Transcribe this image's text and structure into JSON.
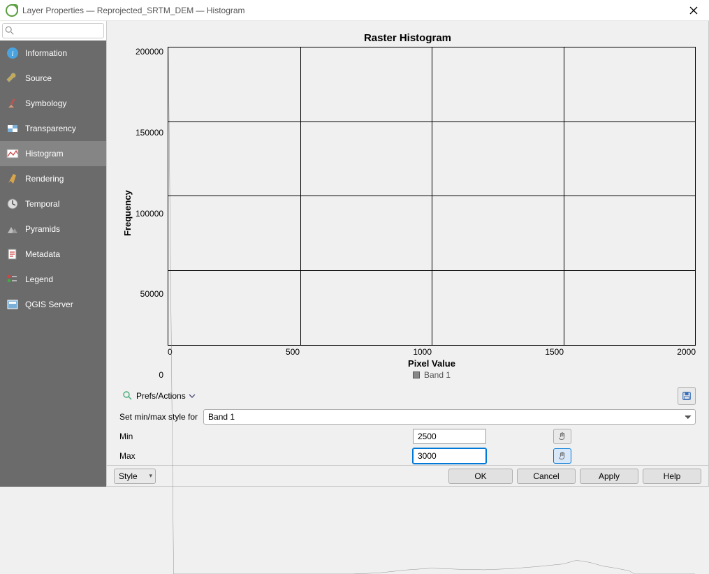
{
  "window": {
    "title": "Layer Properties — Reprojected_SRTM_DEM — Histogram",
    "search_placeholder": ""
  },
  "sidebar": {
    "items": [
      {
        "label": "Information",
        "icon": "info-icon"
      },
      {
        "label": "Source",
        "icon": "wrench-icon"
      },
      {
        "label": "Symbology",
        "icon": "paintbrush-icon"
      },
      {
        "label": "Transparency",
        "icon": "transparency-icon"
      },
      {
        "label": "Histogram",
        "icon": "histogram-icon"
      },
      {
        "label": "Rendering",
        "icon": "brush-icon"
      },
      {
        "label": "Temporal",
        "icon": "clock-icon"
      },
      {
        "label": "Pyramids",
        "icon": "pyramids-icon"
      },
      {
        "label": "Metadata",
        "icon": "metadata-icon"
      },
      {
        "label": "Legend",
        "icon": "legend-icon"
      },
      {
        "label": "QGIS Server",
        "icon": "server-icon"
      }
    ],
    "selected": 4
  },
  "chart_data": {
    "type": "line",
    "title": "Raster Histogram",
    "xlabel": "Pixel Value",
    "ylabel": "Frequency",
    "xlim": [
      0,
      2000
    ],
    "ylim": [
      0,
      200000
    ],
    "xticks": [
      0,
      500,
      1000,
      1500,
      2000
    ],
    "yticks": [
      0,
      50000,
      100000,
      150000,
      200000
    ],
    "series": [
      {
        "name": "Band 1",
        "x": [
          0,
          20,
          50,
          700,
          800,
          900,
          1000,
          1100,
          1200,
          1300,
          1400,
          1500,
          1550,
          1600,
          1650,
          1700,
          1750,
          1770,
          2000
        ],
        "y": [
          200000,
          0,
          0,
          0,
          400,
          1500,
          2200,
          1800,
          1600,
          2000,
          2800,
          3800,
          5200,
          4400,
          3000,
          2200,
          1200,
          0,
          0
        ]
      }
    ],
    "legend": "Band 1"
  },
  "controls": {
    "prefs_label": "Prefs/Actions",
    "setminmax_label": "Set min/max style for",
    "band_select": "Band 1",
    "min_label": "Min",
    "min_value": "2500",
    "max_label": "Max",
    "max_value": "3000"
  },
  "buttons": {
    "style": "Style",
    "ok": "OK",
    "cancel": "Cancel",
    "apply": "Apply",
    "help": "Help"
  }
}
